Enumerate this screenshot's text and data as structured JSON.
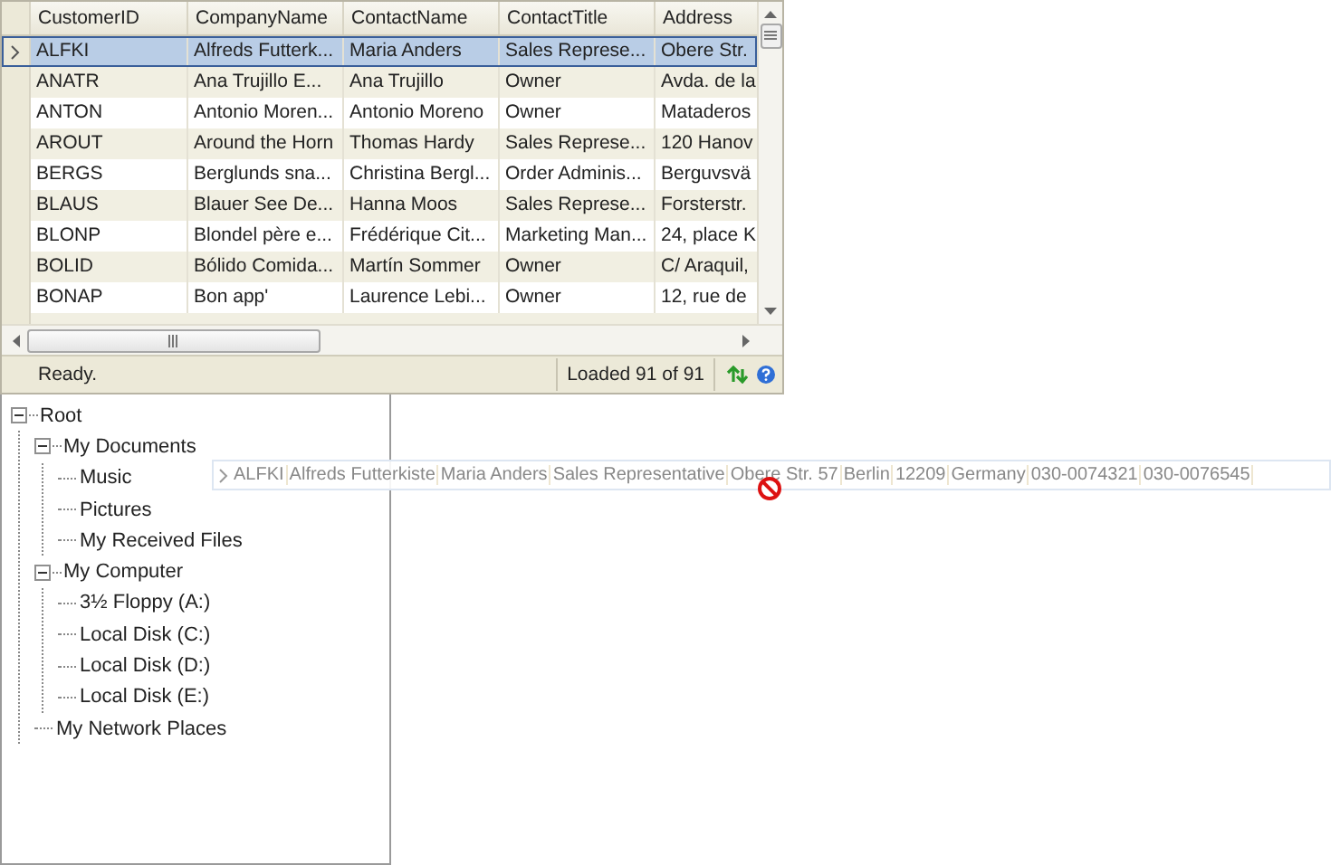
{
  "grid": {
    "columns": [
      "CustomerID",
      "CompanyName",
      "ContactName",
      "ContactTitle",
      "Address"
    ],
    "rows": [
      {
        "cells": [
          "ALFKI",
          "Alfreds Futterk...",
          "Maria Anders",
          "Sales Represe...",
          "Obere Str."
        ],
        "selected": true
      },
      {
        "cells": [
          "ANATR",
          "Ana Trujillo E...",
          "Ana Trujillo",
          "Owner",
          "Avda. de la"
        ],
        "selected": false
      },
      {
        "cells": [
          "ANTON",
          "Antonio Moren...",
          "Antonio Moreno",
          "Owner",
          "Mataderos"
        ],
        "selected": false
      },
      {
        "cells": [
          "AROUT",
          "Around the Horn",
          "Thomas Hardy",
          "Sales Represe...",
          "120 Hanov"
        ],
        "selected": false
      },
      {
        "cells": [
          "BERGS",
          "Berglunds sna...",
          "Christina Bergl...",
          "Order Adminis...",
          "Berguvsvä"
        ],
        "selected": false
      },
      {
        "cells": [
          "BLAUS",
          "Blauer See De...",
          "Hanna Moos",
          "Sales Represe...",
          "Forsterstr."
        ],
        "selected": false
      },
      {
        "cells": [
          "BLONP",
          "Blondel père e...",
          "Frédérique Cit...",
          "Marketing Man...",
          "24, place K"
        ],
        "selected": false
      },
      {
        "cells": [
          "BOLID",
          "Bólido Comida...",
          "Martín Sommer",
          "Owner",
          "C/ Araquil,"
        ],
        "selected": false
      },
      {
        "cells": [
          "BONAP",
          "Bon app'",
          "Laurence Lebi...",
          "Owner",
          "12, rue de"
        ],
        "selected": false
      }
    ]
  },
  "status_bar": {
    "message": "Ready.",
    "count": "Loaded 91 of 91"
  },
  "tree": {
    "nodes": [
      {
        "label": "Root",
        "expanded": true,
        "children": [
          {
            "label": "My Documents",
            "expanded": true,
            "children": [
              {
                "label": "Music"
              },
              {
                "label": "Pictures"
              },
              {
                "label": "My Received Files"
              }
            ]
          },
          {
            "label": "My Computer",
            "expanded": true,
            "children": [
              {
                "label": "3½ Floppy (A:)"
              },
              {
                "label": "Local Disk (C:)"
              },
              {
                "label": "Local Disk (D:)"
              },
              {
                "label": "Local Disk (E:)"
              }
            ]
          },
          {
            "label": "My Network Places"
          }
        ]
      }
    ]
  },
  "drag_preview": {
    "cells": [
      "ALFKI",
      "Alfreds Futterkiste",
      "Maria Anders",
      "Sales Representative",
      "Obere Str. 57",
      "Berlin",
      "12209",
      "Germany",
      "030-0074321",
      "030-0076545"
    ]
  }
}
